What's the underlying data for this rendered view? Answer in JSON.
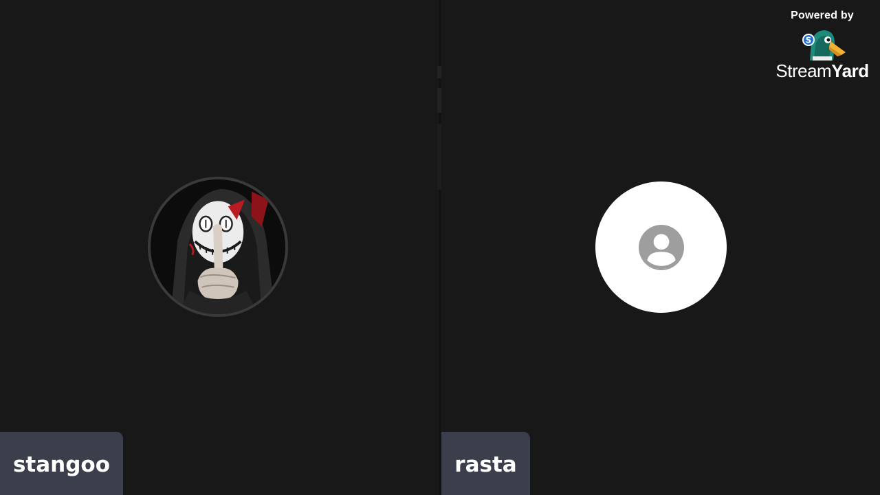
{
  "participants": [
    {
      "name": "stangoo",
      "avatar": "custom-photo"
    },
    {
      "name": "rasta",
      "avatar": "default-person-icon"
    }
  ],
  "branding": {
    "powered_by": "Powered by",
    "brand_part1": "Stream",
    "brand_part2": "Yard",
    "logo_icon": "duck-mascot-icon"
  },
  "colors": {
    "background": "#181818",
    "name_tag": "#3a3f4b",
    "placeholder_circle": "#ffffff",
    "placeholder_icon": "#9e9e9e"
  }
}
